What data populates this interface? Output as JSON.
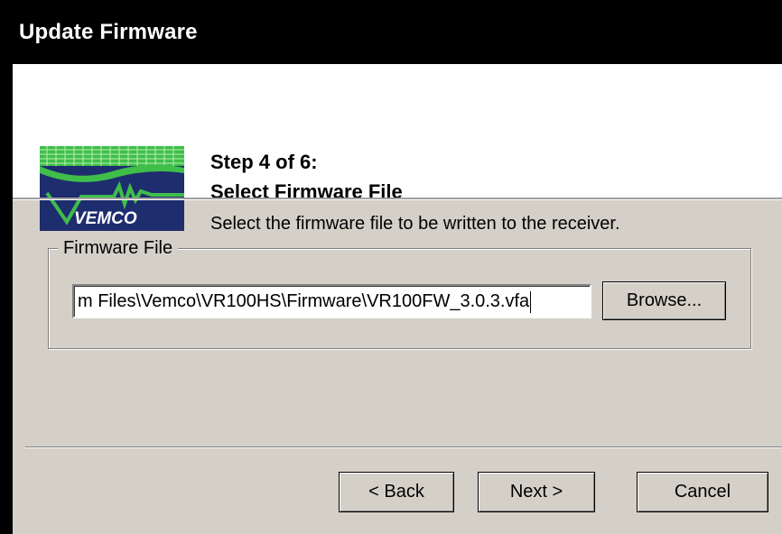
{
  "window": {
    "title": "Update Firmware"
  },
  "header": {
    "step": "Step 4 of 6:",
    "title": "Select Firmware File",
    "description": "Select the firmware file to be written to the receiver.",
    "logo_text": "VEMCO"
  },
  "firmware_group": {
    "label": "Firmware File",
    "path_value": "m Files\\Vemco\\VR100HS\\Firmware\\VR100FW_3.0.3.vfa",
    "browse_label": "Browse..."
  },
  "footer": {
    "back_label": "< Back",
    "next_label": "Next >",
    "cancel_label": "Cancel"
  },
  "colors": {
    "dialog_bg": "#d4d0c8",
    "header_bg": "#ffffff",
    "logo_navy": "#1e2d6e",
    "logo_green": "#3fbe4a"
  }
}
